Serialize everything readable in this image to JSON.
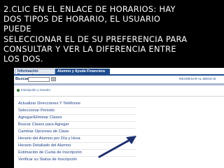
{
  "instructions": {
    "line1": "2.CLIC EN EL ENLACE DE HORARIOS: HAY",
    "line2": "DOS TIPOS DE HORARIO, EL USUARIO",
    "line3": "PUEDE",
    "line4": "SELECCIONAR EL DE SU PREFERENCIA PARA",
    "line5": "CONSULTAR Y VER LA DIFERENCIA ENTRE",
    "line6": "LOS DOS."
  },
  "tabs": {
    "personal": "Información Personal",
    "student": "Alumno y Ayuda Financiera"
  },
  "search": {
    "label": "Buscar",
    "value": "",
    "go_label": "»"
  },
  "header": {
    "return_link": "REGRESAR AL MENÚ  M"
  },
  "breadcrumb": {
    "text": "Inscripción y Horario"
  },
  "menu": {
    "items": [
      "Actualizar Direcciones Y Teléfonos",
      "Seleccionar Periodo",
      "Agregar/Eliminar Clases",
      "Buscar Clases para Agregar",
      "Cambiar Opciones de Clase",
      "Horario del Alumno por Día y Hora",
      "Horario Detallado del Alumno",
      "Estimación de Cuota de Inscripción",
      "Verificar su Status de Inscripción"
    ]
  },
  "colors": {
    "link": "#1c3f88",
    "tab_active": "#1f4d8f",
    "arrow": "#1d2f6e"
  }
}
